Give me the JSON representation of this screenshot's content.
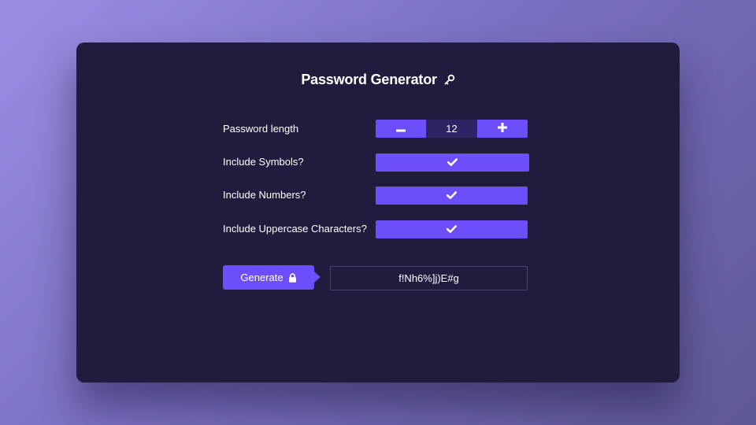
{
  "title": "Password Generator",
  "title_icon": "key-icon",
  "length": {
    "label": "Password length",
    "value": "12",
    "decrement_icon": "minus-icon",
    "increment_icon": "plus-icon"
  },
  "options": [
    {
      "label": "Include Symbols?",
      "checked": true,
      "icon": "check-icon"
    },
    {
      "label": "Include Numbers?",
      "checked": true,
      "icon": "check-icon"
    },
    {
      "label": "Include Uppercase Characters?",
      "checked": true,
      "icon": "check-icon"
    }
  ],
  "generate": {
    "label": "Generate",
    "icon": "lock-icon"
  },
  "result": "f!Nh6%]j)E#g",
  "colors": {
    "card_background": "#1f1c3d",
    "accent": "#6c4ffa",
    "stepper_value_background": "#2d2464",
    "text": "#ffffff"
  }
}
